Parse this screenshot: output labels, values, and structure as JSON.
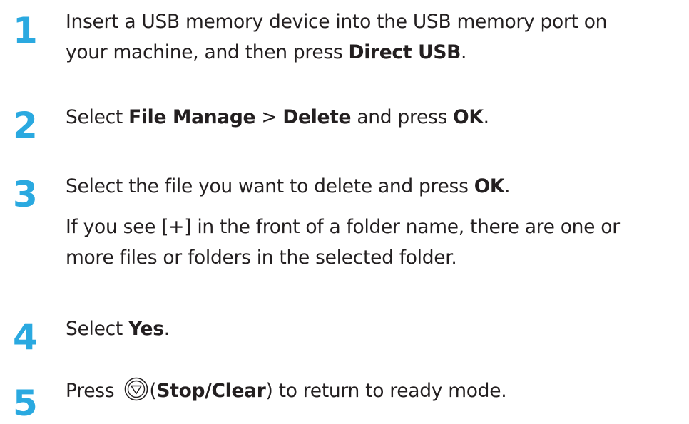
{
  "steps": [
    {
      "number": "1",
      "line1": "Insert a USB memory device into the USB memory port on",
      "line2_pre": "your machine, and then press ",
      "line2_bold": "Direct USB",
      "line2_post": "."
    },
    {
      "number": "2",
      "pre": "Select ",
      "bold1": "File Manage",
      "mid1": " > ",
      "bold2": "Delete",
      "mid2": " and press ",
      "bold3": "OK",
      "post": "."
    },
    {
      "number": "3",
      "pre": "Select the file you want to delete and press ",
      "bold": "OK",
      "post": ".",
      "note_line1": "If you see [+] in the front of a folder name, there are one or",
      "note_line2": "more files or folders in the selected folder."
    },
    {
      "number": "4",
      "pre": "Select ",
      "bold": "Yes",
      "post": "."
    },
    {
      "number": "5",
      "pre": "Press ",
      "icon": "stop-clear-icon",
      "paren_open": "(",
      "bold": "Stop/Clear",
      "paren_close": ")",
      "post": " to return to ready mode."
    }
  ],
  "colors": {
    "step_number": "#2aa9e0",
    "text": "#231f20"
  }
}
